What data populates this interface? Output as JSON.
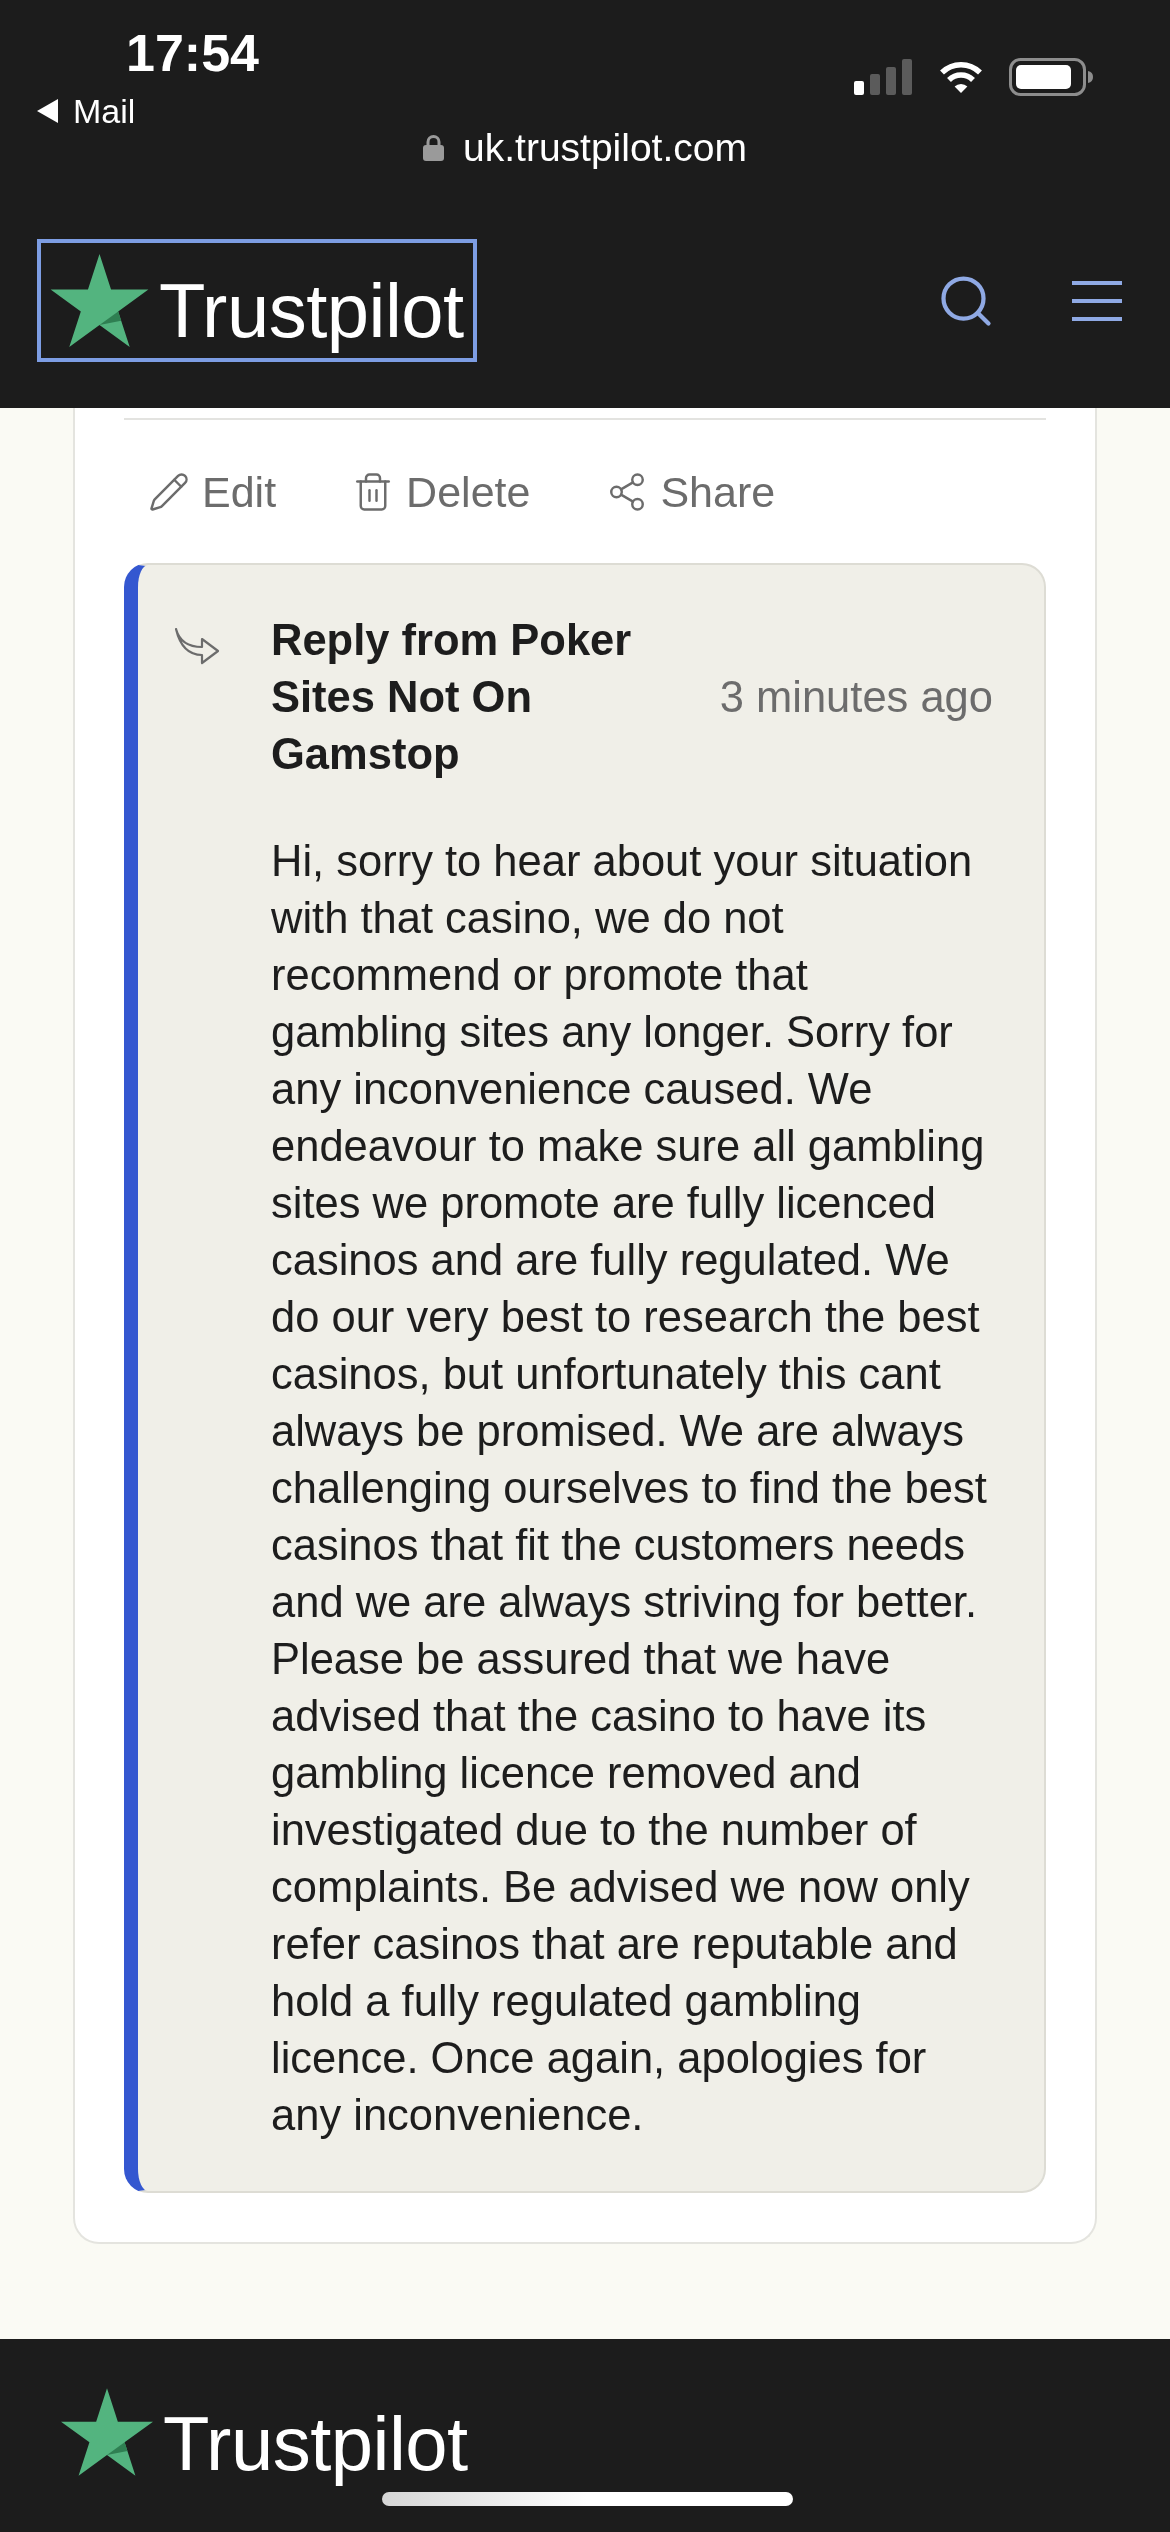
{
  "status_bar": {
    "time": "17:54",
    "back_label": "Mail",
    "url": "uk.trustpilot.com"
  },
  "header": {
    "logo_text": "Trustpilot"
  },
  "review_actions": [
    {
      "kind": "edit",
      "label": "Edit"
    },
    {
      "kind": "delete",
      "label": "Delete"
    },
    {
      "kind": "share",
      "label": "Share"
    }
  ],
  "reply": {
    "title": "Reply from Poker Sites Not On Gamstop",
    "time": "3 minutes ago",
    "text": "Hi, sorry to hear about your situation with that casino, we do not recommend or promote that gambling sites any longer. Sorry for any inconvenience caused. We endeavour to make sure all gambling sites we promote are fully licenced casinos and are fully regulated. We do our very best to research the best casinos, but unfortunately this cant always be promised. We are always challenging ourselves to find the best casinos that fit the customers needs and we are always striving for better. Please be assured that we have advised that the casino to have its gambling licence removed and investigated due to the number of complaints. Be advised we now only refer casinos that are reputable and hold a fully regulated gambling licence. Once again, apologies for any inconvenience."
  },
  "footer": {
    "logo_text": "Trustpilot"
  }
}
